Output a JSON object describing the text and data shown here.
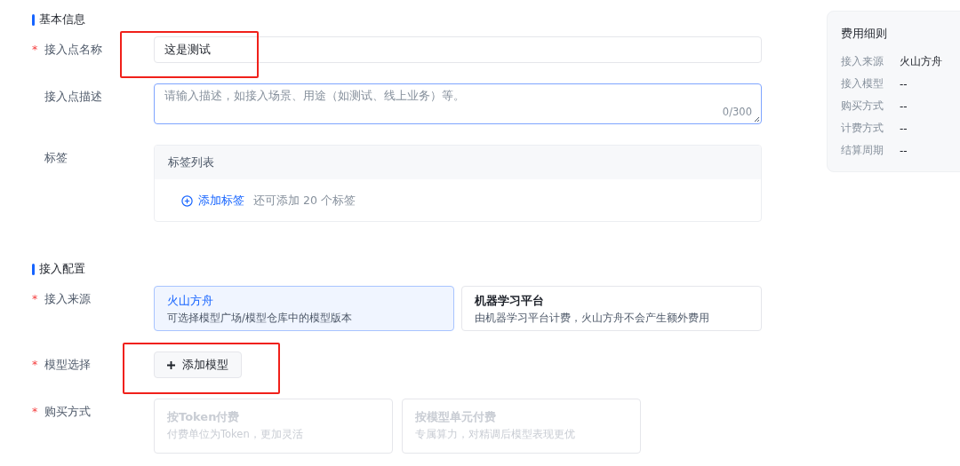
{
  "sections": [
    {
      "title": "基本信息",
      "fields": [
        {
          "kind": "text",
          "label": "接入点名称",
          "required_mark": "*",
          "annotated": true,
          "value": "这是测试"
        },
        {
          "kind": "textarea",
          "label": "接入点描述",
          "annotated": false,
          "focused": true,
          "placeholder": "请输入描述，如接入场景、用途（如测试、线上业务）等。",
          "counter": "0/300"
        },
        {
          "kind": "tags",
          "label": "标签",
          "annotated": false,
          "header": "标签列表",
          "add_label": "添加标签",
          "hint": "还可添加 20 个标签"
        }
      ]
    },
    {
      "title": "接入配置",
      "fields": [
        {
          "kind": "cards",
          "label": "接入来源",
          "required_mark": "*",
          "annotated": false,
          "options": [
            {
              "title": "火山方舟",
              "desc": "可选择模型广场/模型仓库中的模型版本",
              "selected": true,
              "disabled": false
            },
            {
              "title": "机器学习平台",
              "desc": "由机器学习平台计费，火山方舟不会产生额外费用",
              "selected": false,
              "disabled": false
            }
          ]
        },
        {
          "kind": "button",
          "label": "模型选择",
          "required_mark": "*",
          "annotated": true,
          "button": "添加模型"
        },
        {
          "kind": "cards",
          "label": "购买方式",
          "required_mark": "*",
          "annotated": false,
          "options": [
            {
              "title": "按Token付费",
              "desc": "付费单位为Token，更加灵活",
              "selected": false,
              "disabled": true
            },
            {
              "title": "按模型单元付费",
              "desc": "专属算力，对精调后模型表现更优",
              "selected": false,
              "disabled": true
            }
          ]
        }
      ]
    }
  ],
  "summary": {
    "title": "费用细则",
    "rows": [
      {
        "label": "接入来源",
        "value": "火山方舟"
      },
      {
        "label": "接入模型",
        "value": "--"
      },
      {
        "label": "购买方式",
        "value": "--"
      },
      {
        "label": "计费方式",
        "value": "--"
      },
      {
        "label": "结算周期",
        "value": "--"
      }
    ]
  }
}
